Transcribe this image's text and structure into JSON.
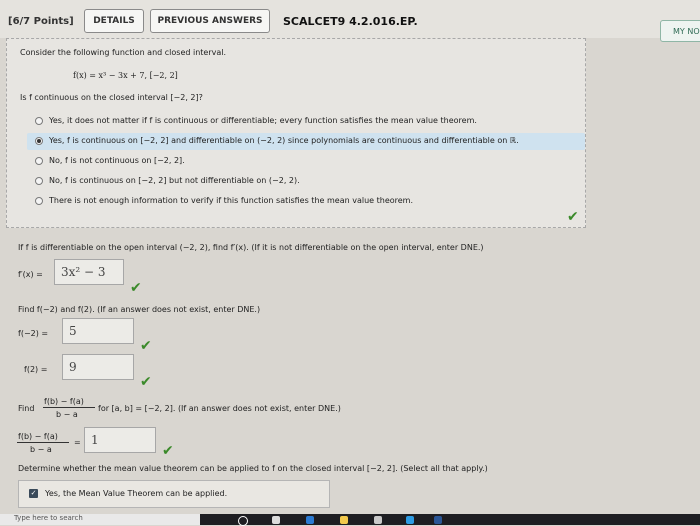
{
  "header": {
    "points": "[6/7 Points]",
    "details_label": "DETAILS",
    "previous_answers_label": "PREVIOUS ANSWERS",
    "problem_code": "SCALCET9 4.2.016.EP.",
    "my_notes_label": "MY NO"
  },
  "question1": {
    "prompt": "Consider the following function and closed interval.",
    "function": "f(x) = x³ − 3x + 7,    [−2, 2]",
    "ask": "Is f continuous on the closed interval [−2, 2]?",
    "options": [
      {
        "label": "Yes, it does not matter if f is continuous or differentiable; every function satisfies the mean value theorem.",
        "selected": false
      },
      {
        "label": "Yes, f is continuous on [−2, 2] and differentiable on (−2, 2) since polynomials are continuous and differentiable on ℝ.",
        "selected": true
      },
      {
        "label": "No, f is not continuous on [−2, 2].",
        "selected": false
      },
      {
        "label": "No, f is continuous on [−2, 2] but not differentiable on (−2, 2).",
        "selected": false
      },
      {
        "label": "There is not enough information to verify if this function satisfies the mean value theorem.",
        "selected": false
      }
    ]
  },
  "question2": {
    "prompt": "If f is differentiable on the open interval (−2, 2), find f′(x). (If it is not differentiable on the open interval, enter DNE.)",
    "lhs": "f′(x) =",
    "answer": "3x² − 3"
  },
  "question3": {
    "prompt": "Find f(−2) and f(2). (If an answer does not exist, enter DNE.)",
    "lhs1": "f(−2) =",
    "answer1": "5",
    "lhs2": "f(2) =",
    "answer2": "9"
  },
  "question4": {
    "find_label": "Find",
    "frac_num": "f(b) − f(a)",
    "frac_den": "b − a",
    "rest": "for [a, b] = [−2, 2]. (If an answer does not exist, enter DNE.)",
    "lhs_num": "f(b) − f(a)",
    "lhs_den": "b − a",
    "equals": "=",
    "answer": "1"
  },
  "question5": {
    "prompt": "Determine whether the mean value theorem can be applied to f on the closed interval [−2, 2]. (Select all that apply.)",
    "option1": "Yes, the Mean Value Theorem can be applied."
  },
  "taskbar": {
    "search_placeholder": "Type here to search"
  },
  "colors": {
    "selected_highlight": "#cfe2ef",
    "correct_check": "#3b8a2a"
  }
}
